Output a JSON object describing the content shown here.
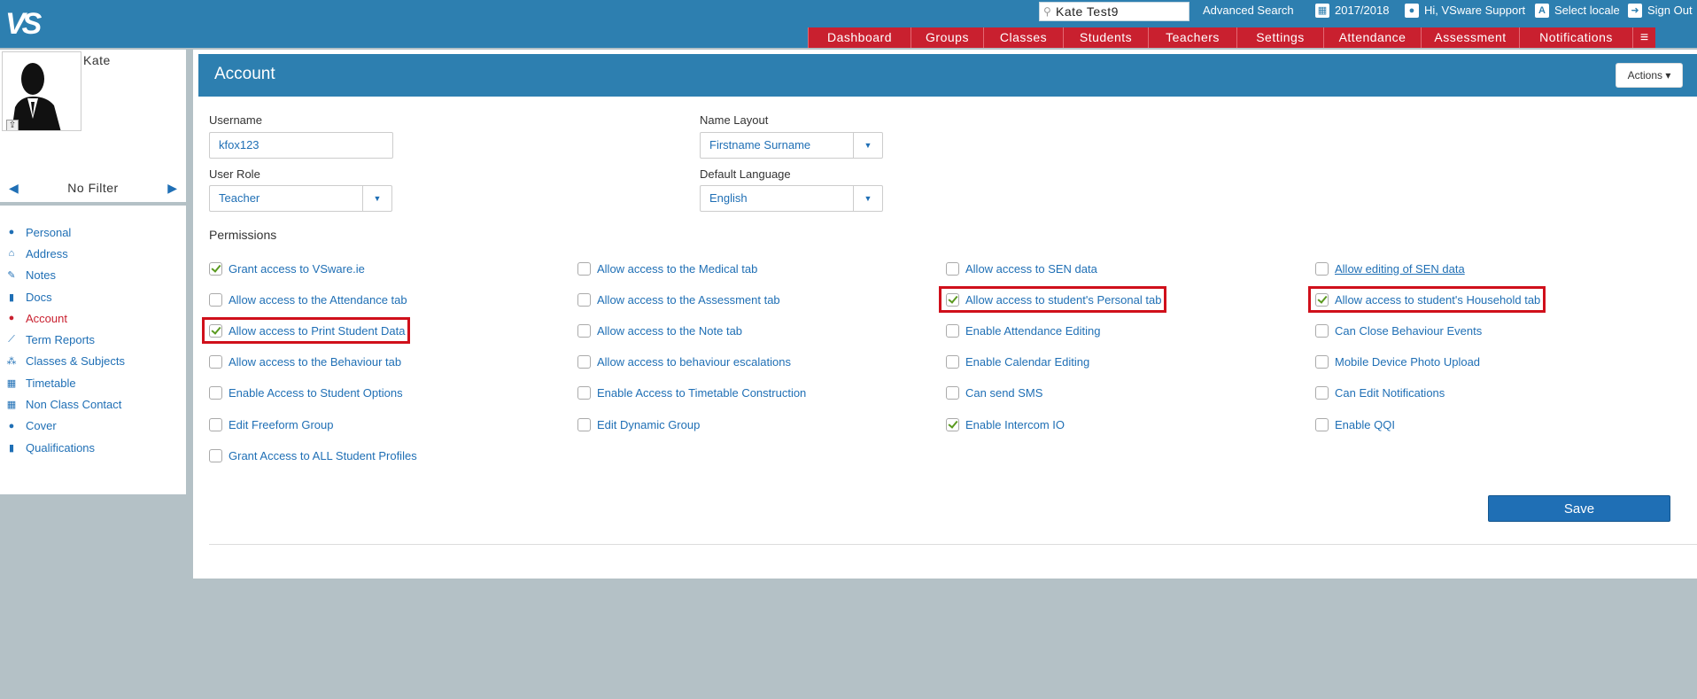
{
  "top": {
    "logo": "VS",
    "search_value": "Kate Test9",
    "advanced_search": "Advanced Search",
    "year": "2017/2018",
    "user_greeting": "Hi, VSware Support",
    "select_locale": "Select locale",
    "sign_out": "Sign Out"
  },
  "nav": [
    {
      "label": "Dashboard",
      "w": 116
    },
    {
      "label": "Groups",
      "w": 82
    },
    {
      "label": "Classes",
      "w": 90
    },
    {
      "label": "Students",
      "w": 96
    },
    {
      "label": "Teachers",
      "w": 100
    },
    {
      "label": "Settings",
      "w": 98
    },
    {
      "label": "Attendance",
      "w": 110
    },
    {
      "label": "Assessment",
      "w": 111
    },
    {
      "label": "Notifications",
      "w": 128
    }
  ],
  "sidebar": {
    "student_name": "Kate",
    "filter_label": "No Filter",
    "items": [
      {
        "label": "Personal",
        "icon": "person-icon",
        "glyph": "●"
      },
      {
        "label": "Address",
        "icon": "home-icon",
        "glyph": "⌂"
      },
      {
        "label": "Notes",
        "icon": "edit-icon",
        "glyph": "✎"
      },
      {
        "label": "Docs",
        "icon": "document-icon",
        "glyph": "▮"
      },
      {
        "label": "Account",
        "icon": "person-icon",
        "glyph": "●",
        "active": true
      },
      {
        "label": "Term Reports",
        "icon": "chart-icon",
        "glyph": "⟋"
      },
      {
        "label": "Classes & Subjects",
        "icon": "users-icon",
        "glyph": "⁂"
      },
      {
        "label": "Timetable",
        "icon": "calendar-icon",
        "glyph": "▦"
      },
      {
        "label": "Non Class Contact",
        "icon": "calendar-icon",
        "glyph": "▦"
      },
      {
        "label": "Cover",
        "icon": "person-icon",
        "glyph": "●"
      },
      {
        "label": "Qualifications",
        "icon": "document-icon",
        "glyph": "▮"
      }
    ]
  },
  "main": {
    "title": "Account",
    "actions_label": "Actions ▾",
    "username_label": "Username",
    "username_value": "kfox123",
    "user_role_label": "User Role",
    "user_role_value": "Teacher",
    "name_layout_label": "Name Layout",
    "name_layout_value": "Firstname Surname",
    "default_language_label": "Default Language",
    "default_language_value": "English",
    "permissions_title": "Permissions",
    "save_label": "Save"
  },
  "permissions": [
    [
      {
        "label": "Grant access to VSware.ie",
        "checked": true
      },
      {
        "label": "Allow access to the Attendance tab",
        "checked": false
      },
      {
        "label": "Allow access to Print Student Data",
        "checked": true,
        "highlight": true
      },
      {
        "label": "Allow access to the Behaviour tab",
        "checked": false
      },
      {
        "label": "Enable Access to Student Options",
        "checked": false
      },
      {
        "label": "Edit Freeform Group",
        "checked": false
      },
      {
        "label": "Grant Access to ALL Student Profiles",
        "checked": false
      }
    ],
    [
      {
        "label": "Allow access to the Medical tab",
        "checked": false
      },
      {
        "label": "Allow access to the Assessment tab",
        "checked": false
      },
      {
        "label": "Allow access to the Note tab",
        "checked": false
      },
      {
        "label": "Allow access to behaviour escalations",
        "checked": false
      },
      {
        "label": "Enable Access to Timetable Construction",
        "checked": false
      },
      {
        "label": "Edit Dynamic Group",
        "checked": false
      }
    ],
    [
      {
        "label": "Allow access to SEN data",
        "checked": false
      },
      {
        "label": "Allow access to student's Personal tab",
        "checked": true,
        "highlight": true
      },
      {
        "label": "Enable Attendance Editing",
        "checked": false
      },
      {
        "label": "Enable Calendar Editing",
        "checked": false
      },
      {
        "label": "Can send SMS",
        "checked": false
      },
      {
        "label": "Enable Intercom IO",
        "checked": true
      }
    ],
    [
      {
        "label": "Allow editing of SEN data",
        "checked": false,
        "underline": true
      },
      {
        "label": "Allow access to student's Household tab",
        "checked": true,
        "highlight": true
      },
      {
        "label": "Can Close Behaviour Events",
        "checked": false
      },
      {
        "label": "Mobile Device Photo Upload",
        "checked": false
      },
      {
        "label": "Can Edit Notifications",
        "checked": false
      },
      {
        "label": "Enable QQI",
        "checked": false
      }
    ]
  ]
}
